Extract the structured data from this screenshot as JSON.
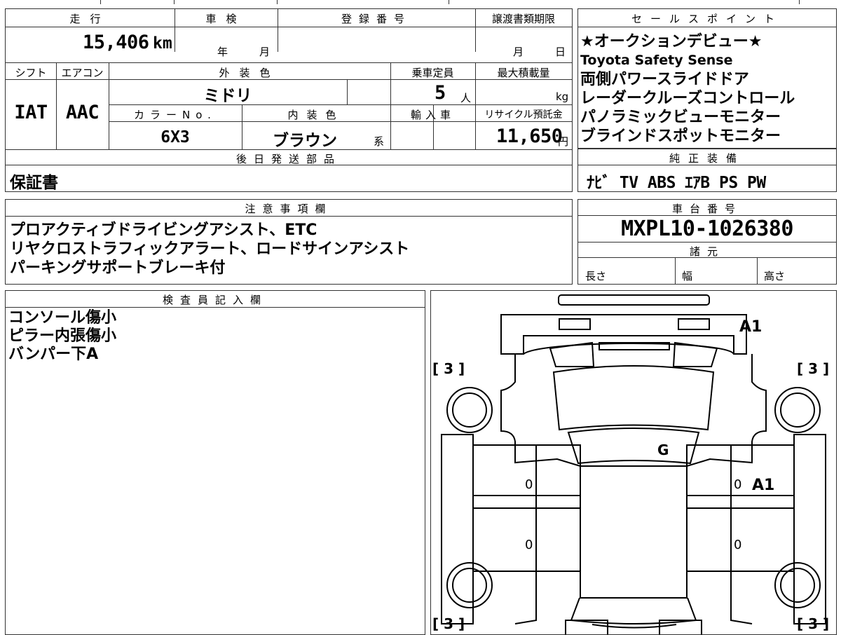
{
  "header": {
    "mileage_label": "走行",
    "mileage_value": "15,406",
    "mileage_unit": "km",
    "shaken_label": "車検",
    "shaken_year": "年",
    "shaken_month": "月",
    "registration_label": "登録番号",
    "transfer_deadline_label": "譲渡書類期限",
    "transfer_month": "月",
    "transfer_day": "日"
  },
  "specs": {
    "shift_label": "シフト",
    "shift_value": "IAT",
    "aircon_label": "エアコン",
    "aircon_value": "AAC",
    "exterior_color_label": "外装色",
    "exterior_color_value": "ミドリ",
    "color_no_label": "カラーNo.",
    "color_no_value": "6X3",
    "interior_color_label": "内装色",
    "interior_color_value": "ブラウン",
    "interior_suffix": "系",
    "capacity_label": "乗車定員",
    "capacity_value": "5",
    "capacity_unit": "人",
    "max_load_label": "最大積載量",
    "max_load_unit": "kg",
    "import_label": "輸入車",
    "recycle_label": "リサイクル預託金",
    "recycle_value": "11,650",
    "recycle_unit": "円"
  },
  "later_parts": {
    "label": "後日発送部品",
    "value": "保証書"
  },
  "sales_points": {
    "label": "セールスポイント",
    "items": [
      "★オークションデビュー★",
      "Toyota Safety Sense",
      "両側パワースライドドア",
      "レーダークルーズコントロール",
      "パノラミックビューモニター",
      "ブラインドスポットモニター"
    ]
  },
  "equipment": {
    "label": "純正装備",
    "value": "ﾅﾋﾞ TV ABS ｴｱB PS PW"
  },
  "notes": {
    "label": "注意事項欄",
    "lines": [
      "プロアクティブドライビングアシスト、ETC",
      "リヤクロストラフィックアラート、ロードサインアシスト",
      "パーキングサポートブレーキ付"
    ]
  },
  "chassis": {
    "label": "車台番号",
    "value": "MXPL10-1026380"
  },
  "dimensions": {
    "label": "諸元",
    "length_label": "長さ",
    "width_label": "幅",
    "height_label": "高さ"
  },
  "inspector": {
    "label": "検査員記入欄",
    "lines": [
      "コンソール傷小",
      "ピラー内張傷小",
      "バンパー下A"
    ]
  },
  "diagram": {
    "marks": {
      "bumper_front": "A1",
      "roof_glass": "G",
      "right_door": "A1",
      "left_front_door": "0",
      "left_rear_door": "0",
      "right_front_door": "0",
      "right_rear_door": "0"
    },
    "tires": {
      "front_left": "[ 3 ]",
      "front_right": "[ 3 ]",
      "rear_left": "[ 3 ]",
      "rear_right": "[ 3 ]"
    }
  }
}
